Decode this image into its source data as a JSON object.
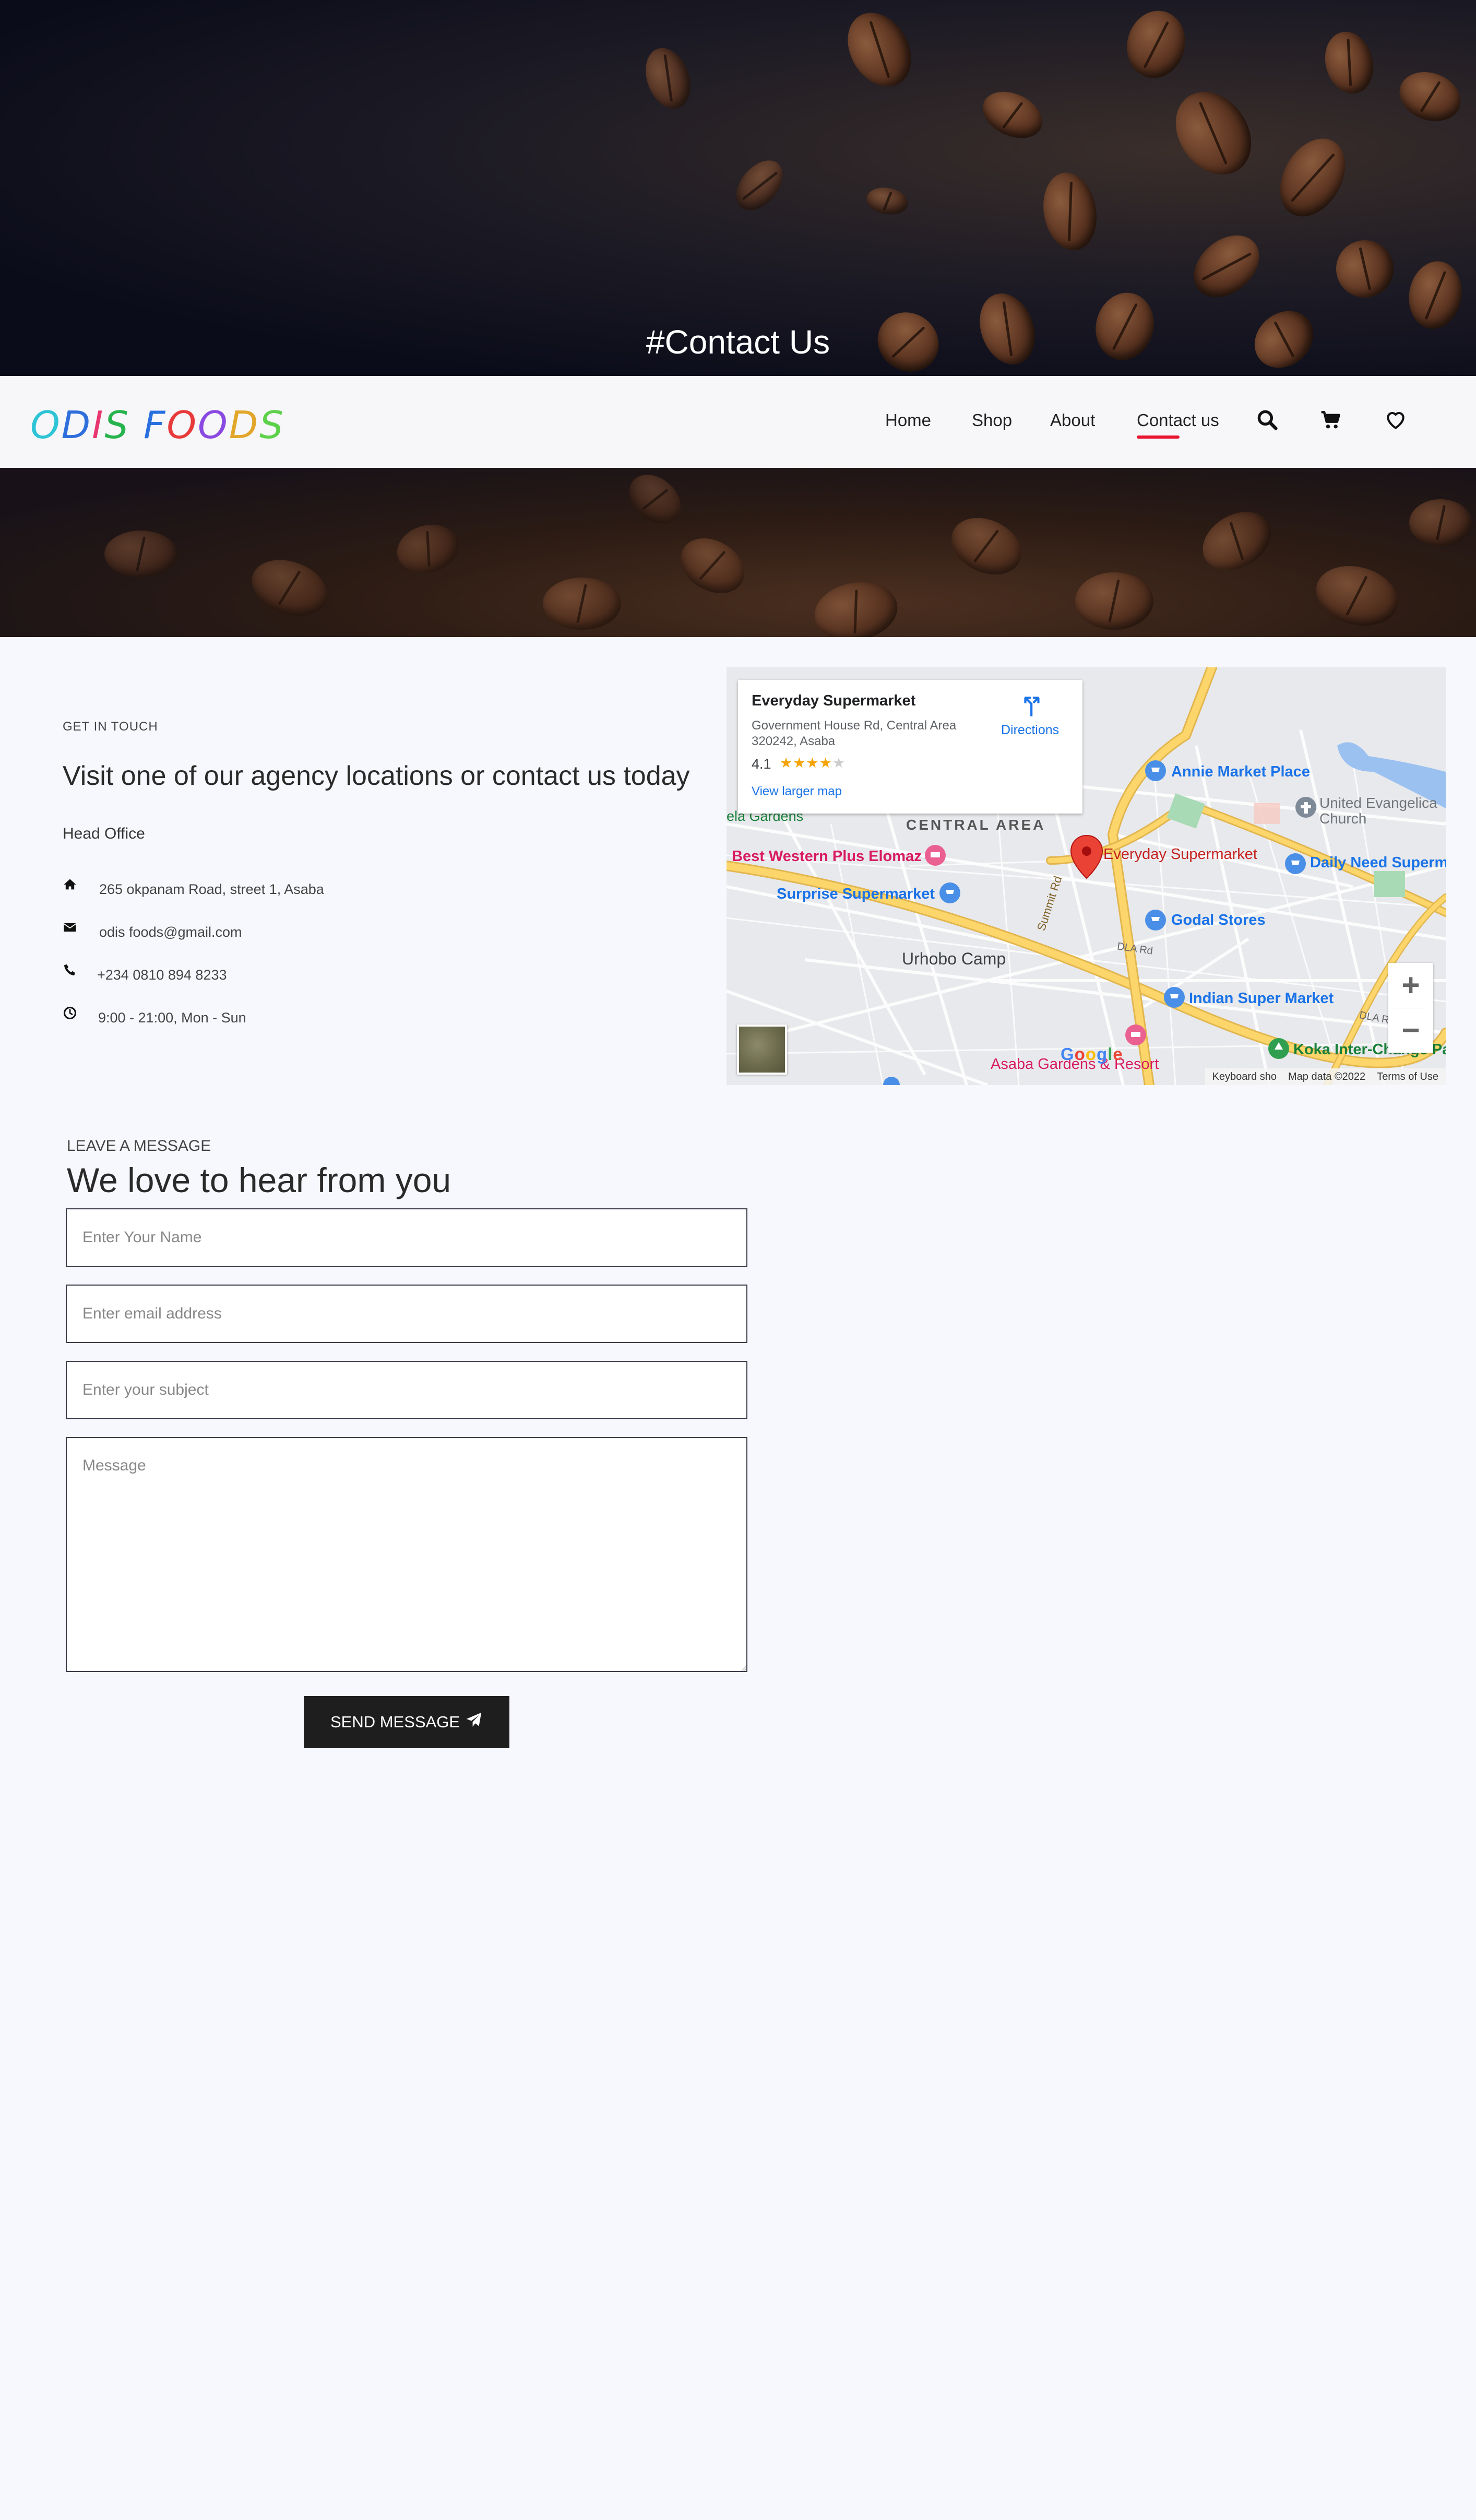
{
  "hero": {
    "title": "#Contact Us"
  },
  "brand": {
    "letters": [
      {
        "ch": "O",
        "color": "#2ec4d6"
      },
      {
        "ch": "D",
        "color": "#2f6fdc"
      },
      {
        "ch": "I",
        "color": "#e8366e"
      },
      {
        "ch": "S",
        "color": "#27b34d"
      },
      {
        "ch": " ",
        "color": "#000000"
      },
      {
        "ch": "F",
        "color": "#2a6fe0"
      },
      {
        "ch": "O",
        "color": "#e83a3a"
      },
      {
        "ch": "O",
        "color": "#8a49e0"
      },
      {
        "ch": "D",
        "color": "#e2a72a"
      },
      {
        "ch": "S",
        "color": "#5dd14a"
      }
    ]
  },
  "nav": {
    "home": "Home",
    "shop": "Shop",
    "about": "About",
    "contact": "Contact us",
    "icons": [
      "search-icon",
      "cart-icon",
      "heart-icon"
    ],
    "active_color": "#e8152f"
  },
  "contact": {
    "eyebrow": "GET IN TOUCH",
    "heading": "Visit one of our agency locations or contact us today",
    "head_office": "Head Office",
    "address": "265 okpanam Road, street 1, Asaba",
    "email": "odis foods@gmail.com",
    "phone": "+234 0810 894 8233",
    "hours": "9:00 - 21:00, Mon - Sun"
  },
  "map": {
    "card": {
      "title": "Everyday Supermarket",
      "address_line1": "Government House Rd, Central Area",
      "address_line2": "320242, Asaba",
      "rating": "4.1",
      "stars": "★★★★",
      "star_off": "★",
      "directions": "Directions",
      "larger_map": "View larger map"
    },
    "labels": {
      "annie": "Annie Market Place",
      "united1": "United Evangelica",
      "united2": "Church",
      "daily": "Daily Need Superm",
      "central": "CENTRAL AREA",
      "best_western": "Best Western Plus Elomaz",
      "everyday": "Everyday Supermarket",
      "surprise": "Surprise Supermarket",
      "godal": "Godal Stores",
      "urhobo": "Urhobo Camp",
      "indian": "Indian Super Market",
      "koka": "Koka Inter-Change Pa",
      "asaba_gardens": "Asaba Gardens & Resort",
      "ela_gardens": "ela Gardens",
      "summit": "Summit Rd",
      "dla1": "DLA Rd",
      "dla2": "DLA R",
      "google": "Google"
    },
    "footer": {
      "keyboard": "Keyboard sho",
      "data": "Map data ©2022",
      "terms": "Terms of Use"
    },
    "zoom_in": "+",
    "zoom_out": "−"
  },
  "form": {
    "eyebrow": "LEAVE A MESSAGE",
    "heading": "We love to hear from you",
    "name_placeholder": "Enter Your Name",
    "email_placeholder": "Enter email address",
    "subject_placeholder": "Enter your subject",
    "message_placeholder": "Message",
    "submit": "SEND MESSAGE"
  }
}
